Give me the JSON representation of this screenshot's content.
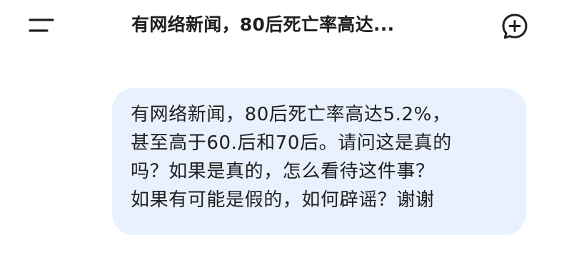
{
  "header": {
    "menu_icon": "menu-icon",
    "title": "有网络新闻，80后死亡率高达...",
    "new_chat_icon": "new-chat-plus-icon"
  },
  "conversation": {
    "user_message": {
      "lines": [
        "有网络新闻，80后死亡率高达5.2%，",
        "甚至高于60.后和70后。请问这是真的",
        "吗？如果是真的，怎么看待这件事？",
        "如果有可能是假的，如何辟谣？谢谢"
      ]
    }
  },
  "colors": {
    "bubble_background": "#e8f1fd",
    "text": "#1f1f1f",
    "background": "#ffffff"
  }
}
